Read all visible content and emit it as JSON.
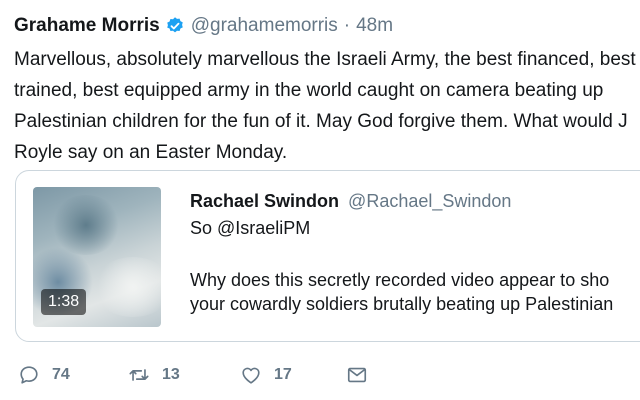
{
  "tweet": {
    "author_name": "Grahame Morris",
    "author_handle": "@grahamemorris",
    "separator": "·",
    "time": "48m",
    "text": "Marvellous, absolutely marvellous the Israeli Army, the best financed, best\ntrained, best equipped army in the world caught on camera beating up\nPalestinian children for the fun of it. May God forgive them. What would J\nRoyle say on an Easter Monday.",
    "icons": {
      "verified": "verified-badge-icon"
    }
  },
  "quoted": {
    "author_name": "Rachael Swindon",
    "author_handle": "@Rachael_Swindon",
    "line1": "So @IsraeliPM",
    "line2": "Why does this secretly recorded video appear to sho",
    "line3": "your cowardly soldiers brutally beating up Palestinian",
    "media_duration": "1:38"
  },
  "actions": {
    "reply_count": "74",
    "retweet_count": "13",
    "like_count": "17",
    "icons": [
      "reply-icon",
      "retweet-icon",
      "like-icon",
      "dm-icon"
    ]
  },
  "colors": {
    "verified": "#1da1f2",
    "secondary_text": "#657786",
    "primary_text": "#14171a",
    "border": "#ccd6dd"
  }
}
